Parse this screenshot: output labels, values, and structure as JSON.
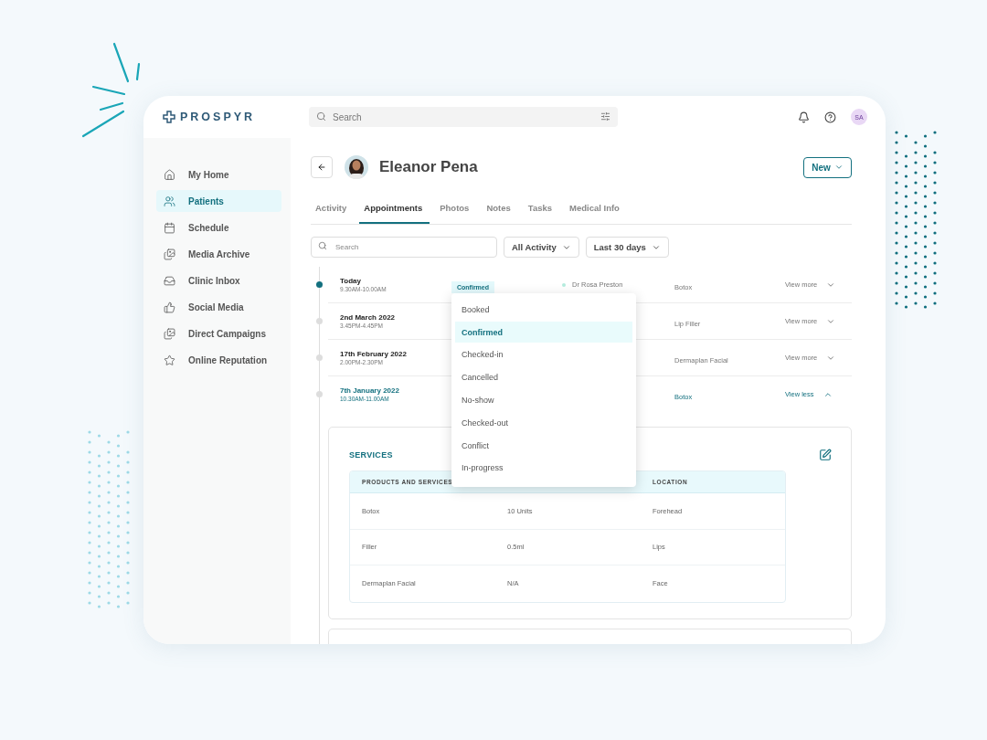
{
  "app": {
    "logo": "PROSPYR",
    "search": {
      "placeholder": "Search"
    },
    "user_initials": "SA"
  },
  "sidebar": {
    "items": [
      {
        "label": "My Home",
        "selected": false
      },
      {
        "label": "Patients",
        "selected": true
      },
      {
        "label": "Schedule",
        "selected": false
      },
      {
        "label": "Media Archive",
        "selected": false
      },
      {
        "label": "Clinic Inbox",
        "selected": false
      },
      {
        "label": "Social Media",
        "selected": false
      },
      {
        "label": "Direct Campaigns",
        "selected": false
      },
      {
        "label": "Online Reputation",
        "selected": false
      }
    ]
  },
  "patient": {
    "name": "Eleanor Pena",
    "new_button": "New"
  },
  "tabs": [
    {
      "label": "Activity",
      "selected": false
    },
    {
      "label": "Appointments",
      "selected": true
    },
    {
      "label": "Photos",
      "selected": false
    },
    {
      "label": "Notes",
      "selected": false
    },
    {
      "label": "Tasks",
      "selected": false
    },
    {
      "label": "Medical Info",
      "selected": false
    }
  ],
  "filters": {
    "search_placeholder": "Search",
    "dropdowns": [
      "All Activity",
      "Last 30 days"
    ]
  },
  "appointments": [
    {
      "date": "Today",
      "time": "9.30AM-10.00AM",
      "status": "Confirmed",
      "doctor": "Dr Rosa Preston",
      "service": "Botox",
      "action": "View more",
      "current": true,
      "expanded": false
    },
    {
      "date": "2nd March 2022",
      "time": "3.45PM-4.45PM",
      "service": "Lip Filler",
      "action": "View more",
      "current": false,
      "expanded": false
    },
    {
      "date": "17th February 2022",
      "time": "2.00PM-2.30PM",
      "service": "Dermaplan Facial",
      "action": "View more",
      "current": false,
      "expanded": false
    },
    {
      "date": "7th January 2022",
      "time": "10.30AM-11.00AM",
      "service": "Botox",
      "action": "View less",
      "current": false,
      "expanded": true
    }
  ],
  "status_menu": [
    {
      "label": "Booked",
      "selected": false
    },
    {
      "label": "Confirmed",
      "selected": true
    },
    {
      "label": "Checked-in",
      "selected": false
    },
    {
      "label": "Cancelled",
      "selected": false
    },
    {
      "label": "No-show",
      "selected": false
    },
    {
      "label": "Checked-out",
      "selected": false
    },
    {
      "label": "Conflict",
      "selected": false
    },
    {
      "label": "In-progress",
      "selected": false
    }
  ],
  "services": {
    "title": "SERVICES",
    "columns": [
      "PRODUCTS AND SERVICES",
      "",
      "LOCATION"
    ],
    "rows": [
      [
        "Botox",
        "10 Units",
        "Forehead"
      ],
      [
        "Filler",
        "0.5ml",
        "Lips"
      ],
      [
        "Dermaplan Facial",
        "N/A",
        "Face"
      ]
    ]
  }
}
